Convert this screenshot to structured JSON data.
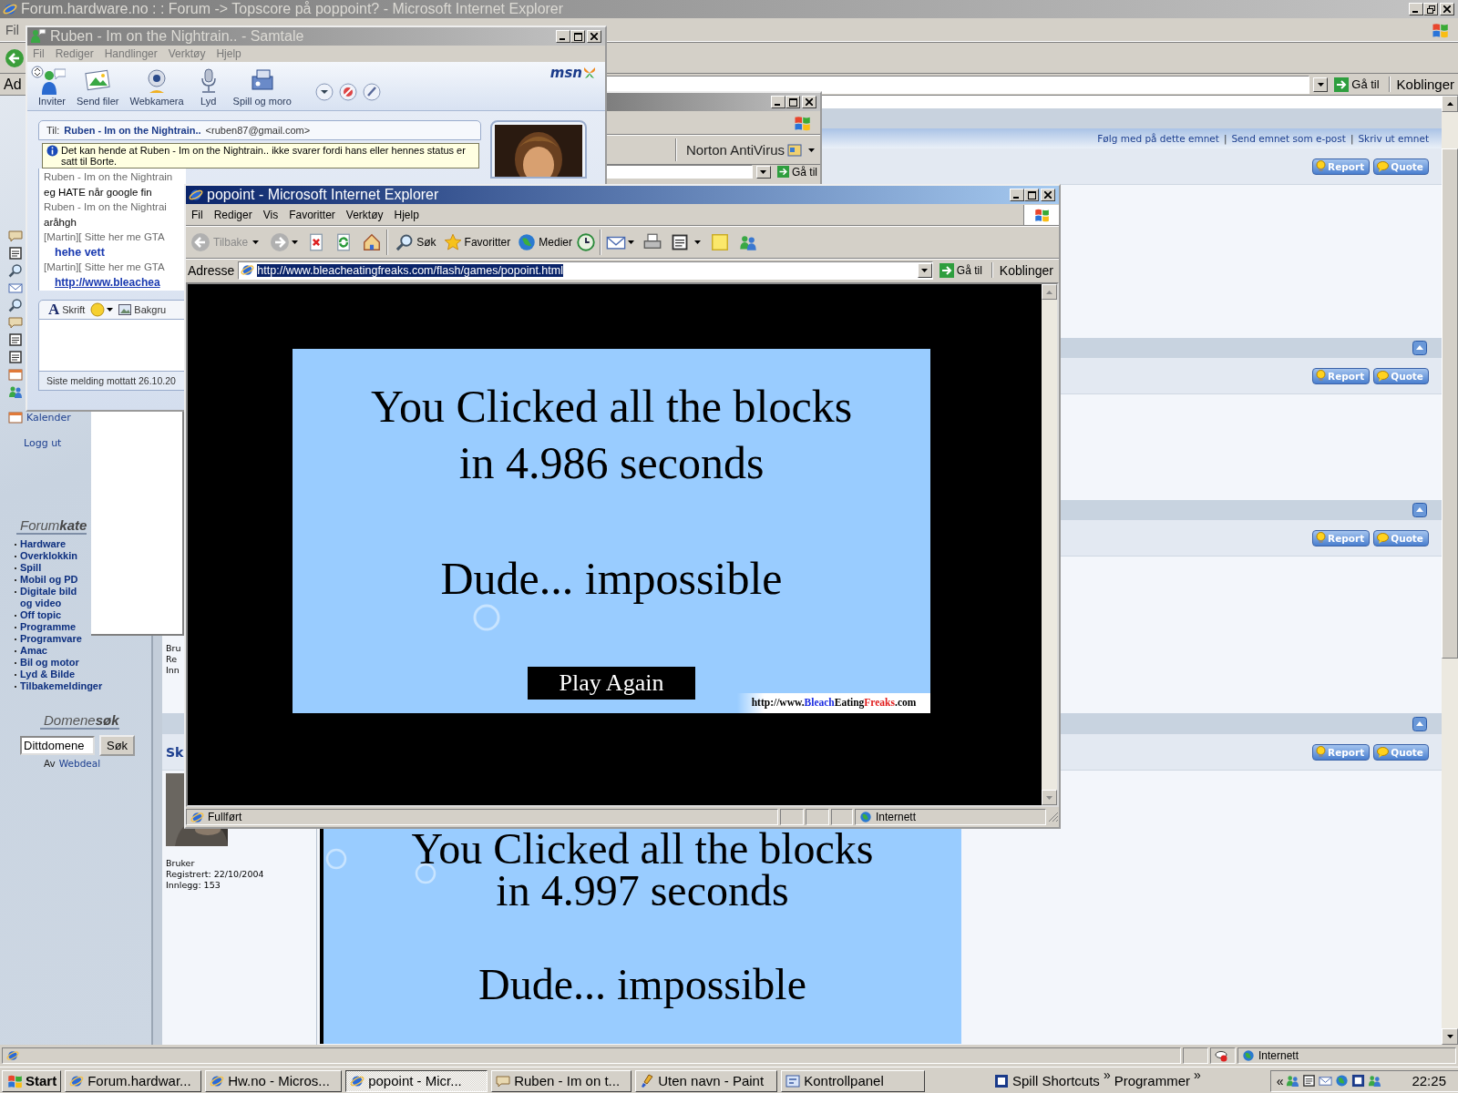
{
  "forum_window": {
    "title": "Forum.hardware.no : : Forum -> Topscore på poppoint? - Microsoft Internet Explorer",
    "menu": [
      "Fil"
    ],
    "address_label": "Ad",
    "go_button": "Gå til",
    "links_button": "Koblinger",
    "sidebar": {
      "nav": [
        {
          "label": "Kalender",
          "kind": "calendar"
        },
        {
          "label": "Logg ut",
          "kind": "text"
        }
      ],
      "categories_heading": "Forum**kate**",
      "categories": [
        "Hardware",
        "Overklokkin",
        "Spill",
        "Mobil og PD",
        "Digitale bild\nog video",
        "Off topic",
        "Programme",
        "Programvare",
        "Amac",
        "Bil og motor",
        "Lyd & Bilde",
        "Tilbakemeldinger"
      ],
      "domain_heading": "Domene**søk**",
      "domain_field": {
        "value": "Dittdomene"
      },
      "domain_button": "Søk",
      "credit": {
        "prefix": "Av",
        "link": "Webdeal"
      }
    },
    "topic_links": [
      {
        "label": "Følg med på dette emnet",
        "kind": "link"
      },
      {
        "label": "|",
        "kind": "separator"
      },
      {
        "label": "Send emnet som e-post",
        "kind": "link"
      },
      {
        "label": "|",
        "kind": "separator"
      },
      {
        "label": "Skriv ut emnet",
        "kind": "link"
      }
    ],
    "posts": [
      {
        "buttons": [
          {
            "label": "Report",
            "kind": "report"
          },
          {
            "label": "Quote",
            "kind": "quote"
          }
        ]
      },
      {
        "buttons": [
          {
            "label": "Report",
            "kind": "report"
          },
          {
            "label": "Quote",
            "kind": "quote"
          }
        ]
      },
      {
        "buttons": [
          {
            "label": "Report",
            "kind": "report"
          },
          {
            "label": "Quote",
            "kind": "quote"
          }
        ],
        "user_info": [
          "Bru",
          "Re",
          "Inn"
        ]
      },
      {
        "buttons": [
          {
            "label": "Report",
            "kind": "report"
          },
          {
            "label": "Quote",
            "kind": "quote"
          }
        ],
        "author": "Sk",
        "avatar": {
          "kind": "picture"
        },
        "user_info": [
          "Bruker",
          "Registrert: 22/10/2004",
          "Innlegg: 153"
        ],
        "attachment": {
          "lines": [
            "You Clicked all the blocks",
            "in 4.997 seconds",
            "Dude... impossible"
          ]
        }
      }
    ],
    "status_bar": {
      "zone": "Internett"
    }
  },
  "background_window": {
    "toolbar_item": "Norton AntiVirus",
    "go_button": "Gå til"
  },
  "chat_window": {
    "title": "Ruben - Im on the Nightrain.. - Samtale",
    "menu": [
      "Fil",
      "Rediger",
      "Handlinger",
      "Verktøy",
      "Hjelp"
    ],
    "toolbar": [
      {
        "kind": "invite",
        "label": "Inviter"
      },
      {
        "kind": "files",
        "label": "Send filer"
      },
      {
        "kind": "webcam",
        "label": "Webkamera"
      },
      {
        "kind": "sound",
        "label": "Lyd"
      },
      {
        "kind": "games",
        "label": "Spill og moro"
      }
    ],
    "logo": "msn",
    "to": {
      "label": "Til:",
      "name": "Ruben - Im on the Nightrain..",
      "email": "<ruben87@gmail.com>"
    },
    "notice": "Det kan hende at Ruben - Im on the Nightrain.. ikke svarer fordi hans eller hennes status er satt til Borte.",
    "messages": [
      {
        "kind": "sender",
        "text": "Ruben - Im on the Nightrain"
      },
      {
        "kind": "message",
        "text": "eg HATE når google fin"
      },
      {
        "kind": "sender",
        "text": "Ruben - Im on the Nightrai"
      },
      {
        "kind": "message",
        "text": "aråhgh"
      },
      {
        "kind": "sender",
        "text": "[Martin][ Sitte her me GTA"
      },
      {
        "kind": "reply",
        "text": "hehe vett"
      },
      {
        "kind": "sender",
        "text": "[Martin][ Sitte her me GTA"
      },
      {
        "kind": "link",
        "text": "http://www.bleachea"
      }
    ],
    "font_button": {
      "glyph": "A",
      "label": "Skrift"
    },
    "background_button": "Bakgru",
    "status": "Siste melding mottatt 26.10.20"
  },
  "browser_window": {
    "title": "popoint - Microsoft Internet Explorer",
    "menu": [
      "Fil",
      "Rediger",
      "Vis",
      "Favoritter",
      "Verktøy",
      "Hjelp"
    ],
    "toolbar": [
      {
        "kind": "back",
        "label": "Tilbake",
        "disabled": true
      },
      {
        "kind": "search",
        "label": "Søk",
        "disabled": false
      },
      {
        "kind": "favorites",
        "label": "Favoritter",
        "disabled": false
      },
      {
        "kind": "media",
        "label": "Medier",
        "disabled": false
      }
    ],
    "address_label": "Adresse",
    "url": "http://www.bleacheatingfreaks.com/flash/games/popoint.html",
    "url_selected": true,
    "go_button": "Gå til",
    "links_button": "Koblinger",
    "game": {
      "lines": [
        "You Clicked all the blocks",
        "in 4.986 seconds",
        "Dude... impossible"
      ],
      "button": "Play Again",
      "credit": [
        {
          "text": "http://www.",
          "kind": "plain"
        },
        {
          "text": "Bleach",
          "kind": "blue"
        },
        {
          "text": "Eating",
          "kind": "plain"
        },
        {
          "text": "Freaks",
          "kind": "red"
        },
        {
          "text": ".com",
          "kind": "plain"
        }
      ]
    },
    "status_bar": {
      "text": "Fullført",
      "zone": "Internett"
    }
  },
  "taskbar": {
    "start": "Start",
    "tasks": [
      {
        "label": "Forum.hardwar...",
        "kind": "browser",
        "selected": false
      },
      {
        "label": "Hw.no - Micros...",
        "kind": "browser",
        "selected": false
      },
      {
        "label": "popoint - Micr...",
        "kind": "browser",
        "selected": true
      },
      {
        "label": "Ruben - Im on t...",
        "kind": "chat",
        "selected": false
      },
      {
        "label": "Uten navn - Paint",
        "kind": "paint",
        "selected": false
      },
      {
        "label": "Kontrollpanel",
        "kind": "control",
        "selected": false
      }
    ],
    "toolbars": [
      {
        "label": "Spill Shortcuts",
        "kind": "games"
      },
      {
        "label": "»",
        "kind": "chevron"
      },
      {
        "label": "Programmer",
        "kind": "plain"
      },
      {
        "label": "»",
        "kind": "chevron"
      }
    ],
    "tray_toggle": "«",
    "clock": "22:25"
  }
}
